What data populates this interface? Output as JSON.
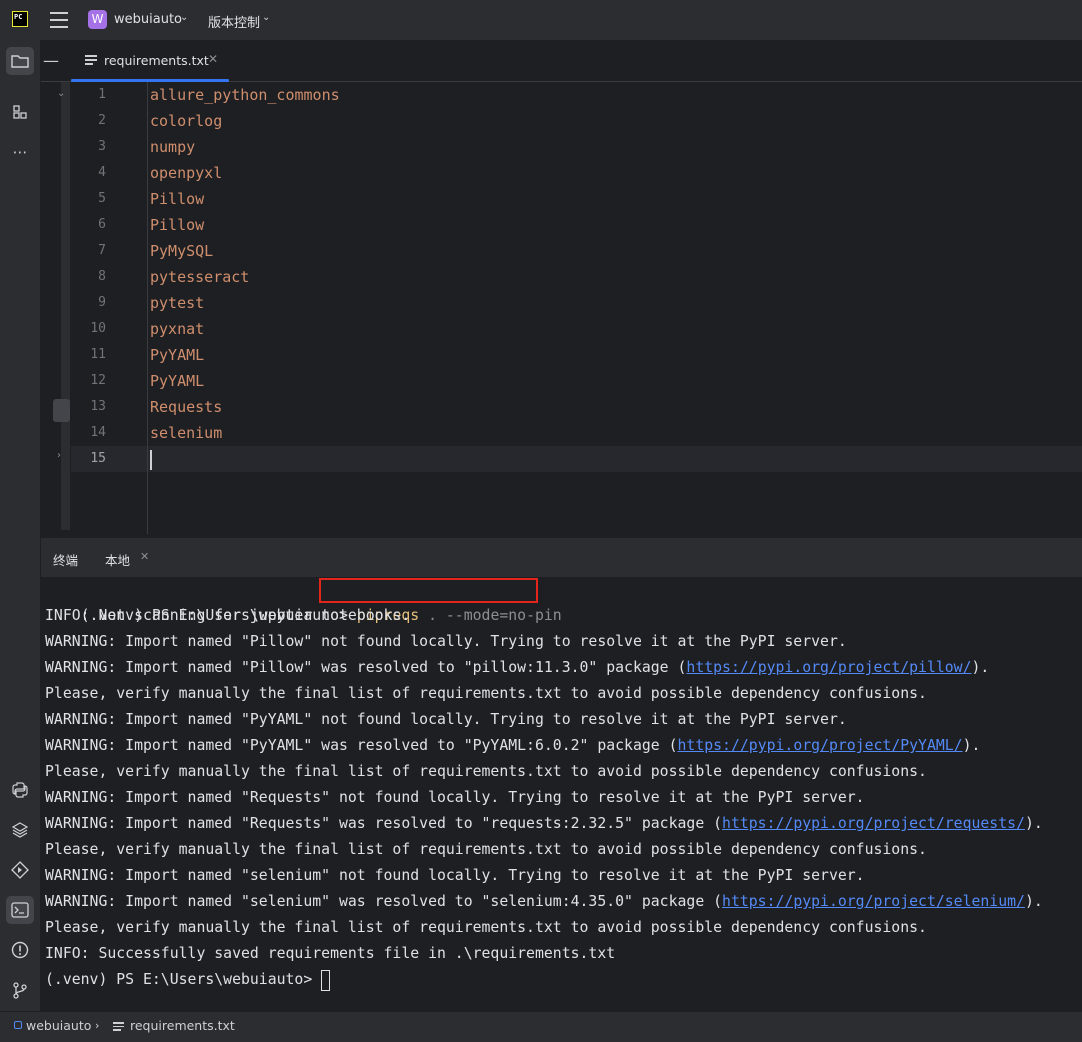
{
  "titlebar": {
    "logo": "PC",
    "project_badge": "W",
    "project_name": "webuiauto",
    "vcs_label": "版本控制"
  },
  "editor": {
    "tab_filename": "requirements.txt",
    "lines": [
      {
        "num": "1",
        "text": "allure_python_commons"
      },
      {
        "num": "2",
        "text": "colorlog"
      },
      {
        "num": "3",
        "text": "numpy"
      },
      {
        "num": "4",
        "text": "openpyxl"
      },
      {
        "num": "5",
        "text": "Pillow"
      },
      {
        "num": "6",
        "text": "Pillow"
      },
      {
        "num": "7",
        "text": "PyMySQL"
      },
      {
        "num": "8",
        "text": "pytesseract"
      },
      {
        "num": "9",
        "text": "pytest"
      },
      {
        "num": "10",
        "text": "pyxnat"
      },
      {
        "num": "11",
        "text": "PyYAML"
      },
      {
        "num": "12",
        "text": "PyYAML"
      },
      {
        "num": "13",
        "text": "Requests"
      },
      {
        "num": "14",
        "text": "selenium"
      },
      {
        "num": "15",
        "text": ""
      }
    ]
  },
  "terminal": {
    "tab_main": "终端",
    "tab_local": "本地",
    "prompt": "(.venv) PS E:\\Users\\webuiauto> ",
    "command": "pipreqs",
    "command_args": " . --mode=no-pin",
    "out": {
      "l1": "INFO: Not scanning for jupyter notebooks.",
      "l2": "WARNING: Import named \"Pillow\" not found locally. Trying to resolve it at the PyPI server.",
      "l3a": "WARNING: Import named \"Pillow\" was resolved to \"pillow:11.3.0\" package (",
      "l3link": "https://pypi.org/project/pillow/",
      "l3b": ").",
      "l4": "Please, verify manually the final list of requirements.txt to avoid possible dependency confusions.",
      "l5": "WARNING: Import named \"PyYAML\" not found locally. Trying to resolve it at the PyPI server.",
      "l6a": "WARNING: Import named \"PyYAML\" was resolved to \"PyYAML:6.0.2\" package (",
      "l6link": "https://pypi.org/project/PyYAML/",
      "l6b": ").",
      "l7": "Please, verify manually the final list of requirements.txt to avoid possible dependency confusions.",
      "l8": "WARNING: Import named \"Requests\" not found locally. Trying to resolve it at the PyPI server.",
      "l9a": "WARNING: Import named \"Requests\" was resolved to \"requests:2.32.5\" package (",
      "l9link": "https://pypi.org/project/requests/",
      "l9b": ").",
      "l10": "Please, verify manually the final list of requirements.txt to avoid possible dependency confusions.",
      "l11": "WARNING: Import named \"selenium\" not found locally. Trying to resolve it at the PyPI server.",
      "l12a": "WARNING: Import named \"selenium\" was resolved to \"selenium:4.35.0\" package (",
      "l12link": "https://pypi.org/project/selenium/",
      "l12b": ").",
      "l13": "Please, verify manually the final list of requirements.txt to avoid possible dependency confusions.",
      "l14": "INFO: Successfully saved requirements file in .\\requirements.txt"
    },
    "prompt2": "(.venv) PS E:\\Users\\webuiauto> "
  },
  "statusbar": {
    "project": "webuiauto",
    "file": "requirements.txt"
  },
  "colors": {
    "accent": "#3574f0",
    "keyword": "#cf8e6d",
    "link": "#548af7",
    "highlight_box": "#e2261c"
  }
}
